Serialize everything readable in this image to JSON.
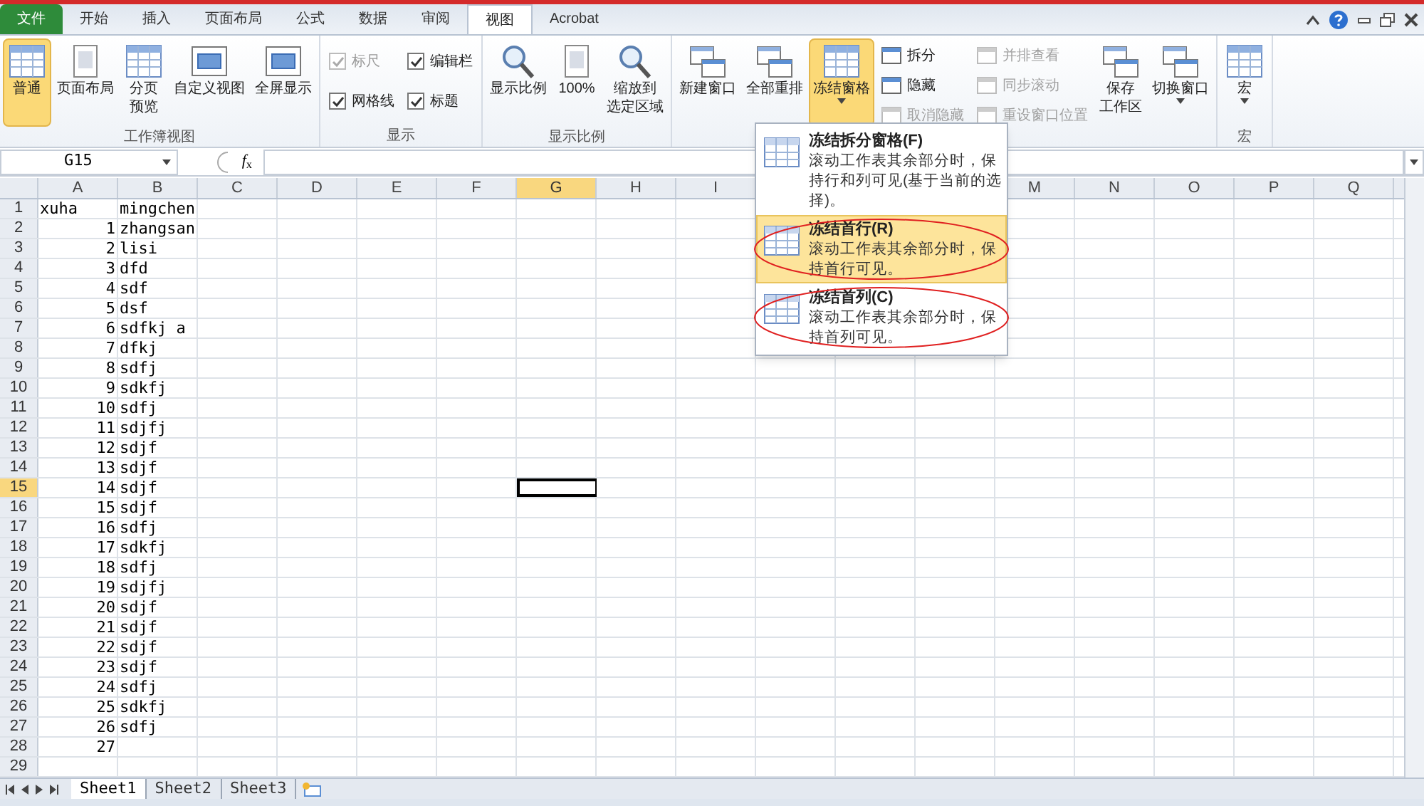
{
  "ribbon_tabs": [
    {
      "label": "文件",
      "kind": "file"
    },
    {
      "label": "开始",
      "kind": "tab",
      "selected": false
    },
    {
      "label": "插入",
      "kind": "tab",
      "selected": false
    },
    {
      "label": "页面布局",
      "kind": "tab",
      "selected": false
    },
    {
      "label": "公式",
      "kind": "tab",
      "selected": false
    },
    {
      "label": "数据",
      "kind": "tab",
      "selected": false
    },
    {
      "label": "审阅",
      "kind": "tab",
      "selected": false
    },
    {
      "label": "视图",
      "kind": "tab",
      "selected": true
    },
    {
      "label": "Acrobat",
      "kind": "tab",
      "selected": false
    }
  ],
  "ribbon_groups": [
    {
      "label": "工作簿视图",
      "controls": [
        {
          "kind": "large",
          "lines": [
            "普通"
          ],
          "selected": true
        },
        {
          "kind": "large",
          "lines": [
            "页面布局"
          ],
          "selected": false
        },
        {
          "kind": "large",
          "lines": [
            "分页",
            "预览"
          ],
          "selected": false
        },
        {
          "kind": "large",
          "lines": [
            "自定义视图"
          ],
          "selected": false
        },
        {
          "kind": "large",
          "lines": [
            "全屏显示"
          ],
          "selected": false
        }
      ]
    },
    {
      "label": "显示",
      "controls": [
        {
          "kind": "checkbox",
          "label": "标尺",
          "checked": true,
          "disabled": true
        },
        {
          "kind": "checkbox",
          "label": "网格线",
          "checked": true,
          "disabled": false
        },
        {
          "kind": "checkbox",
          "label": "编辑栏",
          "checked": true,
          "disabled": false
        },
        {
          "kind": "checkbox",
          "label": "标题",
          "checked": true,
          "disabled": false
        }
      ]
    },
    {
      "label": "显示比例",
      "controls": [
        {
          "kind": "large",
          "lines": [
            "显示比例"
          ],
          "selected": false
        },
        {
          "kind": "large",
          "lines": [
            "100%"
          ],
          "selected": false
        },
        {
          "kind": "large",
          "lines": [
            "缩放到",
            "选定区域"
          ],
          "selected": false
        }
      ]
    },
    {
      "controls": [
        {
          "kind": "large",
          "lines": [
            "新建窗口"
          ],
          "selected": false
        },
        {
          "kind": "large",
          "lines": [
            "全部重排"
          ],
          "selected": false
        },
        {
          "kind": "large",
          "lines": [
            "冻结窗格"
          ],
          "selected": true,
          "dropdown": true
        },
        {
          "kind": "small",
          "label": "拆分",
          "disabled": false
        },
        {
          "kind": "small",
          "label": "隐藏",
          "disabled": false
        },
        {
          "kind": "small",
          "label": "取消隐藏",
          "disabled": true
        },
        {
          "kind": "small",
          "label": "并排查看",
          "disabled": true
        },
        {
          "kind": "small",
          "label": "同步滚动",
          "disabled": true
        },
        {
          "kind": "small",
          "label": "重设窗口位置",
          "disabled": true
        },
        {
          "kind": "large",
          "lines": [
            "保存",
            "工作区"
          ],
          "selected": false
        },
        {
          "kind": "large",
          "lines": [
            "切换窗口"
          ],
          "selected": false,
          "dropdown": true
        }
      ]
    },
    {
      "label": "宏",
      "controls": [
        {
          "kind": "large",
          "lines": [
            "宏"
          ],
          "selected": false,
          "dropdown": true
        }
      ]
    }
  ],
  "formula_bar": {
    "name_box": "G15",
    "function_button": "*f*$_{x}$"
  },
  "columns": [
    {
      "label": "A",
      "selected": false
    },
    {
      "label": "B",
      "selected": false
    },
    {
      "label": "C",
      "selected": false
    },
    {
      "label": "D",
      "selected": false
    },
    {
      "label": "E",
      "selected": false
    },
    {
      "label": "F",
      "selected": false
    },
    {
      "label": "G",
      "selected": true
    },
    {
      "label": "H",
      "selected": false
    },
    {
      "label": "I",
      "selected": false
    }
  ],
  "columns_right": [
    {
      "label": "M",
      "selected": false
    },
    {
      "label": "N",
      "selected": false
    },
    {
      "label": "O",
      "selected": false
    },
    {
      "label": "P",
      "selected": false
    },
    {
      "label": "Q",
      "selected": false
    }
  ],
  "rows": [
    {
      "header": "1",
      "selected": false,
      "cells": [
        {
          "text": "xuha",
          "kind": "text"
        },
        {
          "text": "mingchen",
          "kind": "text"
        }
      ]
    },
    {
      "header": "2",
      "selected": false,
      "cells": [
        {
          "text": "1",
          "kind": "number"
        },
        {
          "text": "zhangsan",
          "kind": "text"
        }
      ]
    },
    {
      "header": "3",
      "selected": false,
      "cells": [
        {
          "text": "2",
          "kind": "number"
        },
        {
          "text": "lisi",
          "kind": "text"
        }
      ]
    },
    {
      "header": "4",
      "selected": false,
      "cells": [
        {
          "text": "3",
          "kind": "number"
        },
        {
          "text": "dfd",
          "kind": "text"
        }
      ]
    },
    {
      "header": "5",
      "selected": false,
      "cells": [
        {
          "text": "4",
          "kind": "number"
        },
        {
          "text": "sdf",
          "kind": "text"
        }
      ]
    },
    {
      "header": "6",
      "selected": false,
      "cells": [
        {
          "text": "5",
          "kind": "number"
        },
        {
          "text": "dsf",
          "kind": "text"
        }
      ]
    },
    {
      "header": "7",
      "selected": false,
      "cells": [
        {
          "text": "6",
          "kind": "number"
        },
        {
          "text": "sdfkj a",
          "kind": "text"
        }
      ]
    },
    {
      "header": "8",
      "selected": false,
      "cells": [
        {
          "text": "7",
          "kind": "number"
        },
        {
          "text": "dfkj",
          "kind": "text"
        }
      ]
    },
    {
      "header": "9",
      "selected": false,
      "cells": [
        {
          "text": "8",
          "kind": "number"
        },
        {
          "text": "sdfj",
          "kind": "text"
        }
      ]
    },
    {
      "header": "10",
      "selected": false,
      "cells": [
        {
          "text": "9",
          "kind": "number"
        },
        {
          "text": "sdkfj",
          "kind": "text"
        }
      ]
    },
    {
      "header": "11",
      "selected": false,
      "cells": [
        {
          "text": "10",
          "kind": "number"
        },
        {
          "text": "sdfj",
          "kind": "text"
        }
      ]
    },
    {
      "header": "12",
      "selected": false,
      "cells": [
        {
          "text": "11",
          "kind": "number"
        },
        {
          "text": "sdjfj",
          "kind": "text"
        }
      ]
    },
    {
      "header": "13",
      "selected": false,
      "cells": [
        {
          "text": "12",
          "kind": "number"
        },
        {
          "text": "sdjf",
          "kind": "text"
        }
      ]
    },
    {
      "header": "14",
      "selected": false,
      "cells": [
        {
          "text": "13",
          "kind": "number"
        },
        {
          "text": "sdjf",
          "kind": "text"
        }
      ]
    },
    {
      "header": "15",
      "selected": true,
      "cells": [
        {
          "text": "14",
          "kind": "number"
        },
        {
          "text": "sdjf",
          "kind": "text"
        }
      ]
    },
    {
      "header": "16",
      "selected": false,
      "cells": [
        {
          "text": "15",
          "kind": "number"
        },
        {
          "text": "sdjf",
          "kind": "text"
        }
      ]
    },
    {
      "header": "17",
      "selected": false,
      "cells": [
        {
          "text": "16",
          "kind": "number"
        },
        {
          "text": "sdfj",
          "kind": "text"
        }
      ]
    },
    {
      "header": "18",
      "selected": false,
      "cells": [
        {
          "text": "17",
          "kind": "number"
        },
        {
          "text": "sdkfj",
          "kind": "text"
        }
      ]
    },
    {
      "header": "19",
      "selected": false,
      "cells": [
        {
          "text": "18",
          "kind": "number"
        },
        {
          "text": "sdfj",
          "kind": "text"
        }
      ]
    },
    {
      "header": "20",
      "selected": false,
      "cells": [
        {
          "text": "19",
          "kind": "number"
        },
        {
          "text": "sdjfj",
          "kind": "text"
        }
      ]
    },
    {
      "header": "21",
      "selected": false,
      "cells": [
        {
          "text": "20",
          "kind": "number"
        },
        {
          "text": "sdjf",
          "kind": "text"
        }
      ]
    },
    {
      "header": "22",
      "selected": false,
      "cells": [
        {
          "text": "21",
          "kind": "number"
        },
        {
          "text": "sdjf",
          "kind": "text"
        }
      ]
    },
    {
      "header": "23",
      "selected": false,
      "cells": [
        {
          "text": "22",
          "kind": "number"
        },
        {
          "text": "sdjf",
          "kind": "text"
        }
      ]
    },
    {
      "header": "24",
      "selected": false,
      "cells": [
        {
          "text": "23",
          "kind": "number"
        },
        {
          "text": "sdjf",
          "kind": "text"
        }
      ]
    },
    {
      "header": "25",
      "selected": false,
      "cells": [
        {
          "text": "24",
          "kind": "number"
        },
        {
          "text": "sdfj",
          "kind": "text"
        }
      ]
    },
    {
      "header": "26",
      "selected": false,
      "cells": [
        {
          "text": "25",
          "kind": "number"
        },
        {
          "text": "sdkfj",
          "kind": "text"
        }
      ]
    },
    {
      "header": "27",
      "selected": false,
      "cells": [
        {
          "text": "26",
          "kind": "number"
        },
        {
          "text": "sdfj",
          "kind": "text"
        }
      ]
    },
    {
      "header": "28",
      "selected": false,
      "cells": [
        {
          "text": "27",
          "kind": "number"
        }
      ]
    },
    {
      "header": "29",
      "selected": false
    }
  ],
  "freeze_menu": [
    {
      "title": "冻结拆分窗格(F)",
      "description": "滚动工作表其余部分时，保持行和列可见(基于当前的选择)。",
      "selected": false,
      "circled": false
    },
    {
      "title": "冻结首行(R)",
      "description": "滚动工作表其余部分时，保持首行可见。",
      "selected": true,
      "circled": true
    },
    {
      "title": "冻结首列(C)",
      "description": "滚动工作表其余部分时，保持首列可见。",
      "selected": false,
      "circled": true
    }
  ],
  "sheet_tabs": [
    {
      "label": "Sheet1",
      "selected": true
    },
    {
      "label": "Sheet2",
      "selected": false
    },
    {
      "label": "Sheet3",
      "selected": false
    }
  ]
}
